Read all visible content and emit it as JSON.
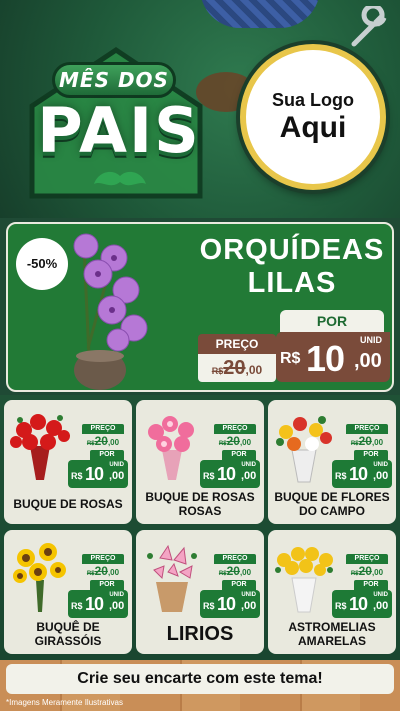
{
  "header": {
    "title_small": "MÊS DOS",
    "title_big": "PAIS",
    "logo_line1": "Sua Logo",
    "logo_line2": "Aqui"
  },
  "feature": {
    "discount": "-50%",
    "name": "ORQUÍDEAS LILAS",
    "preco_label": "PREÇO",
    "por_label": "POR",
    "old_currency": "R$",
    "old_int": "20",
    "old_dec": ",00",
    "new_currency": "R$",
    "new_int": "10",
    "new_dec": ",00",
    "unid": "UNID"
  },
  "products": [
    {
      "name": "BUQUE DE ROSAS",
      "preco_label": "PREÇO",
      "old_currency": "R$",
      "old_int": "20",
      "old_dec": ",00",
      "por_label": "POR",
      "unid": "UNID",
      "new_currency": "R$",
      "new_int": "10",
      "new_dec": ",00"
    },
    {
      "name": "BUQUE DE ROSAS ROSAS",
      "preco_label": "PREÇO",
      "old_currency": "R$",
      "old_int": "20",
      "old_dec": ",00",
      "por_label": "POR",
      "unid": "UNID",
      "new_currency": "R$",
      "new_int": "10",
      "new_dec": ",00"
    },
    {
      "name": "BUQUE DE FLORES DO CAMPO",
      "preco_label": "PREÇO",
      "old_currency": "R$",
      "old_int": "20",
      "old_dec": ",00",
      "por_label": "POR",
      "unid": "UNID",
      "new_currency": "R$",
      "new_int": "10",
      "new_dec": ",00"
    },
    {
      "name": "BUQUÊ DE GIRASSÓIS",
      "preco_label": "PREÇO",
      "old_currency": "R$",
      "old_int": "20",
      "old_dec": ",00",
      "por_label": "POR",
      "unid": "UNID",
      "new_currency": "R$",
      "new_int": "10",
      "new_dec": ",00"
    },
    {
      "name": "LIRIOS",
      "preco_label": "PREÇO",
      "old_currency": "R$",
      "old_int": "20",
      "old_dec": ",00",
      "por_label": "POR",
      "unid": "UNID",
      "new_currency": "R$",
      "new_int": "10",
      "new_dec": ",00"
    },
    {
      "name": "ASTROMELIAS AMARELAS",
      "preco_label": "PREÇO",
      "old_currency": "R$",
      "old_int": "20",
      "old_dec": ",00",
      "por_label": "POR",
      "unid": "UNID",
      "new_currency": "R$",
      "new_int": "10",
      "new_dec": ",00"
    }
  ],
  "footer": {
    "cta": "Crie seu encarte com este tema!",
    "disclaimer": "*Imagens Meramente Ilustrativas"
  },
  "colors": {
    "dark_green": "#1f4a35",
    "price_green": "#1e7a36",
    "brown": "#7a4b3a",
    "logo_ring": "#e8c64a"
  }
}
